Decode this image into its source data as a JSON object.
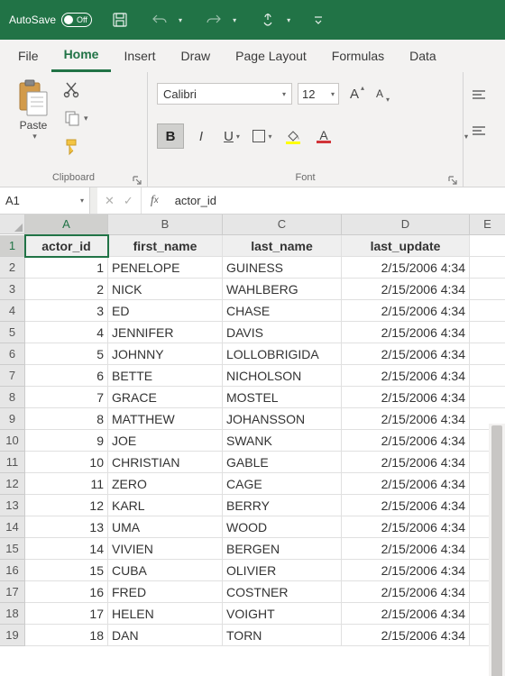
{
  "titlebar": {
    "autosave_label": "AutoSave",
    "autosave_state": "Off"
  },
  "tabs": [
    "File",
    "Home",
    "Insert",
    "Draw",
    "Page Layout",
    "Formulas",
    "Data"
  ],
  "active_tab": "Home",
  "ribbon": {
    "clipboard": {
      "paste": "Paste",
      "group_label": "Clipboard"
    },
    "font": {
      "name": "Calibri",
      "size": "12",
      "bold": "B",
      "italic": "I",
      "underline": "U",
      "group_label": "Font"
    }
  },
  "namebox": "A1",
  "formula": "actor_id",
  "columns": [
    "A",
    "B",
    "C",
    "D",
    "E"
  ],
  "col_widths": {
    "A": 92,
    "B": 127,
    "C": 132,
    "D": 142,
    "E": 40
  },
  "headers": [
    "actor_id",
    "first_name",
    "last_name",
    "last_update"
  ],
  "rows": [
    {
      "id": "1",
      "first": "PENELOPE",
      "last": "GUINESS",
      "upd": "2/15/2006 4:34"
    },
    {
      "id": "2",
      "first": "NICK",
      "last": "WAHLBERG",
      "upd": "2/15/2006 4:34"
    },
    {
      "id": "3",
      "first": "ED",
      "last": "CHASE",
      "upd": "2/15/2006 4:34"
    },
    {
      "id": "4",
      "first": "JENNIFER",
      "last": "DAVIS",
      "upd": "2/15/2006 4:34"
    },
    {
      "id": "5",
      "first": "JOHNNY",
      "last": "LOLLOBRIGIDA",
      "upd": "2/15/2006 4:34"
    },
    {
      "id": "6",
      "first": "BETTE",
      "last": "NICHOLSON",
      "upd": "2/15/2006 4:34"
    },
    {
      "id": "7",
      "first": "GRACE",
      "last": "MOSTEL",
      "upd": "2/15/2006 4:34"
    },
    {
      "id": "8",
      "first": "MATTHEW",
      "last": "JOHANSSON",
      "upd": "2/15/2006 4:34"
    },
    {
      "id": "9",
      "first": "JOE",
      "last": "SWANK",
      "upd": "2/15/2006 4:34"
    },
    {
      "id": "10",
      "first": "CHRISTIAN",
      "last": "GABLE",
      "upd": "2/15/2006 4:34"
    },
    {
      "id": "11",
      "first": "ZERO",
      "last": "CAGE",
      "upd": "2/15/2006 4:34"
    },
    {
      "id": "12",
      "first": "KARL",
      "last": "BERRY",
      "upd": "2/15/2006 4:34"
    },
    {
      "id": "13",
      "first": "UMA",
      "last": "WOOD",
      "upd": "2/15/2006 4:34"
    },
    {
      "id": "14",
      "first": "VIVIEN",
      "last": "BERGEN",
      "upd": "2/15/2006 4:34"
    },
    {
      "id": "15",
      "first": "CUBA",
      "last": "OLIVIER",
      "upd": "2/15/2006 4:34"
    },
    {
      "id": "16",
      "first": "FRED",
      "last": "COSTNER",
      "upd": "2/15/2006 4:34"
    },
    {
      "id": "17",
      "first": "HELEN",
      "last": "VOIGHT",
      "upd": "2/15/2006 4:34"
    },
    {
      "id": "18",
      "first": "DAN",
      "last": "TORN",
      "upd": "2/15/2006 4:34"
    }
  ]
}
